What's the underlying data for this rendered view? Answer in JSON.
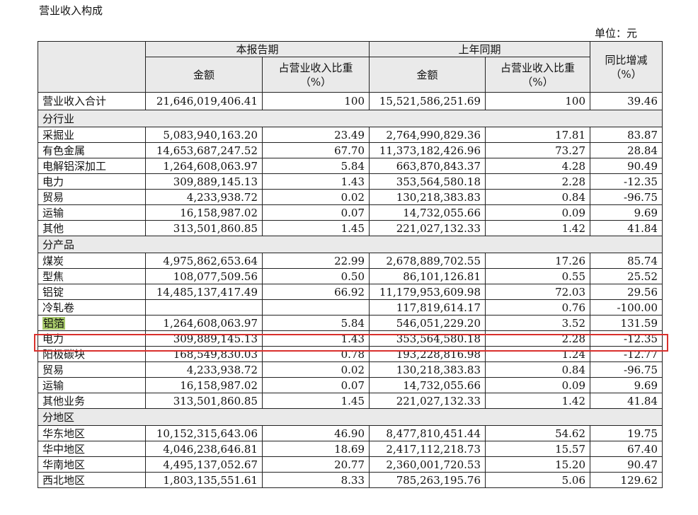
{
  "title": "营业收入构成",
  "unit": "单位：元",
  "header": {
    "current_period": "本报告期",
    "prior_period": "上年同期",
    "yoy": "同比增减",
    "yoy_unit": "（%）",
    "amount": "金额",
    "share": "占营业收入比重",
    "share_unit": "（%）"
  },
  "total": {
    "name": "营业收入合计",
    "cur_amount": "21,646,019,406.41",
    "cur_share": "100",
    "prior_amount": "15,521,586,251.69",
    "prior_share": "100",
    "yoy": "39.46"
  },
  "sections": [
    {
      "title": "分行业",
      "rows": [
        {
          "name": "采掘业",
          "cur_amount": "5,083,940,163.20",
          "cur_share": "23.49",
          "prior_amount": "2,764,990,829.36",
          "prior_share": "17.81",
          "yoy": "83.87"
        },
        {
          "name": "有色金属",
          "cur_amount": "14,653,687,247.52",
          "cur_share": "67.70",
          "prior_amount": "11,373,182,426.96",
          "prior_share": "73.27",
          "yoy": "28.84"
        },
        {
          "name": "电解铝深加工",
          "cur_amount": "1,264,608,063.97",
          "cur_share": "5.84",
          "prior_amount": "663,870,843.37",
          "prior_share": "4.28",
          "yoy": "90.49"
        },
        {
          "name": "电力",
          "cur_amount": "309,889,145.13",
          "cur_share": "1.43",
          "prior_amount": "353,564,580.18",
          "prior_share": "2.28",
          "yoy": "-12.35"
        },
        {
          "name": "贸易",
          "cur_amount": "4,233,938.72",
          "cur_share": "0.02",
          "prior_amount": "130,218,383.83",
          "prior_share": "0.84",
          "yoy": "-96.75"
        },
        {
          "name": "运输",
          "cur_amount": "16,158,987.02",
          "cur_share": "0.07",
          "prior_amount": "14,732,055.66",
          "prior_share": "0.09",
          "yoy": "9.69"
        },
        {
          "name": "其他",
          "cur_amount": "313,501,860.85",
          "cur_share": "1.45",
          "prior_amount": "221,027,132.33",
          "prior_share": "1.42",
          "yoy": "41.84"
        }
      ]
    },
    {
      "title": "分产品",
      "rows": [
        {
          "name": "煤炭",
          "cur_amount": "4,975,862,653.64",
          "cur_share": "22.99",
          "prior_amount": "2,678,889,702.55",
          "prior_share": "17.26",
          "yoy": "85.74"
        },
        {
          "name": "型焦",
          "cur_amount": "108,077,509.56",
          "cur_share": "0.50",
          "prior_amount": "86,101,126.81",
          "prior_share": "0.55",
          "yoy": "25.52"
        },
        {
          "name": "铝锭",
          "cur_amount": "14,485,137,417.49",
          "cur_share": "66.92",
          "prior_amount": "11,179,953,609.98",
          "prior_share": "72.03",
          "yoy": "29.56"
        },
        {
          "name": "冷轧卷",
          "cur_amount": "",
          "cur_share": "",
          "prior_amount": "117,819,614.17",
          "prior_share": "0.76",
          "yoy": "-100.00"
        },
        {
          "name": "铝箔",
          "cur_amount": "1,264,608,063.97",
          "cur_share": "5.84",
          "prior_amount": "546,051,229.20",
          "prior_share": "3.52",
          "yoy": "131.59",
          "highlight": true
        },
        {
          "name": "电力",
          "cur_amount": "309,889,145.13",
          "cur_share": "1.43",
          "prior_amount": "353,564,580.18",
          "prior_share": "2.28",
          "yoy": "-12.35"
        },
        {
          "name": "阳极碳块",
          "cur_amount": "168,549,830.03",
          "cur_share": "0.78",
          "prior_amount": "193,228,816.98",
          "prior_share": "1.24",
          "yoy": "-12.77"
        },
        {
          "name": "贸易",
          "cur_amount": "4,233,938.72",
          "cur_share": "0.02",
          "prior_amount": "130,218,383.83",
          "prior_share": "0.84",
          "yoy": "-96.75"
        },
        {
          "name": "运输",
          "cur_amount": "16,158,987.02",
          "cur_share": "0.07",
          "prior_amount": "14,732,055.66",
          "prior_share": "0.09",
          "yoy": "9.69"
        },
        {
          "name": "其他业务",
          "cur_amount": "313,501,860.85",
          "cur_share": "1.45",
          "prior_amount": "221,027,132.33",
          "prior_share": "1.42",
          "yoy": "41.84"
        }
      ]
    },
    {
      "title": "分地区",
      "rows": [
        {
          "name": "华东地区",
          "cur_amount": "10,152,315,643.06",
          "cur_share": "46.90",
          "prior_amount": "8,477,810,451.44",
          "prior_share": "54.62",
          "yoy": "19.75"
        },
        {
          "name": "华中地区",
          "cur_amount": "4,046,238,646.81",
          "cur_share": "18.69",
          "prior_amount": "2,417,112,218.73",
          "prior_share": "15.57",
          "yoy": "67.40"
        },
        {
          "name": "华南地区",
          "cur_amount": "4,495,137,052.67",
          "cur_share": "20.77",
          "prior_amount": "2,360,001,720.53",
          "prior_share": "15.20",
          "yoy": "90.47"
        },
        {
          "name": "西北地区",
          "cur_amount": "1,803,135,551.61",
          "cur_share": "8.33",
          "prior_amount": "785,263,195.76",
          "prior_share": "5.06",
          "yoy": "129.62"
        }
      ]
    }
  ],
  "colors": {
    "highlight_box": "#d9302c",
    "highlight_text_bg": "#a7c96a",
    "header_bg": "#eaeaea"
  }
}
